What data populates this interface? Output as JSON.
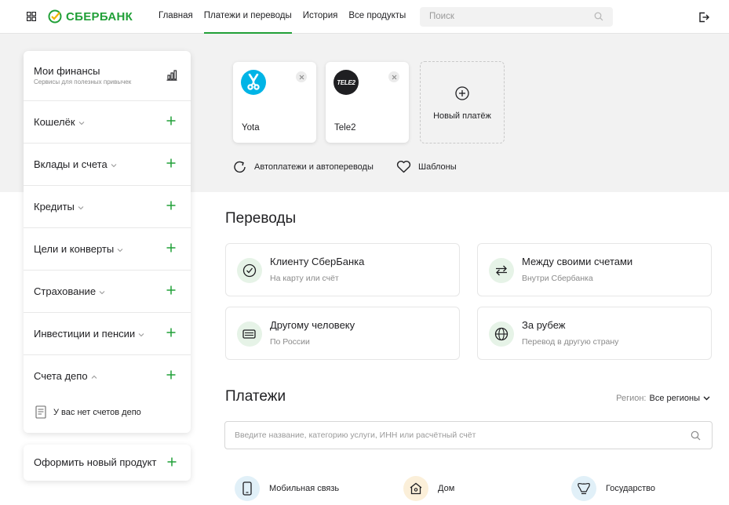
{
  "header": {
    "brand": "СБЕРБАНК",
    "nav": [
      "Главная",
      "Платежи и переводы",
      "История",
      "Все продукты"
    ],
    "active_nav_index": 1,
    "search_placeholder": "Поиск"
  },
  "sidebar": {
    "my_finance": {
      "title": "Мои финансы",
      "subtitle": "Сервисы для полезных привычек"
    },
    "items": [
      {
        "label": "Кошелёк",
        "expanded": false
      },
      {
        "label": "Вклады и счета",
        "expanded": false
      },
      {
        "label": "Кредиты",
        "expanded": false
      },
      {
        "label": "Цели и конверты",
        "expanded": false
      },
      {
        "label": "Страхование",
        "expanded": false
      },
      {
        "label": "Инвестиции и пенсии",
        "expanded": false
      },
      {
        "label": "Счета депо",
        "expanded": true
      }
    ],
    "depo_empty": "У вас нет счетов депо",
    "new_product": "Оформить новый продукт"
  },
  "favorites": {
    "cards": [
      {
        "name": "Yota",
        "icon": "yota-logo"
      },
      {
        "name": "Tele2",
        "icon": "tele2-logo",
        "logo_text": "TELE2"
      }
    ],
    "new_payment": "Новый платёж",
    "autopay": "Автоплатежи и автопереводы",
    "templates": "Шаблоны"
  },
  "transfers": {
    "title": "Переводы",
    "cards": [
      {
        "title": "Клиенту СберБанка",
        "subtitle": "На карту или счёт",
        "icon": "check-circle-icon"
      },
      {
        "title": "Между своими счетами",
        "subtitle": "Внутри Сбербанка",
        "icon": "swap-arrows-icon"
      },
      {
        "title": "Другому человеку",
        "subtitle": "По России",
        "icon": "wallet-icon"
      },
      {
        "title": "За рубеж",
        "subtitle": "Перевод в другую страну",
        "icon": "globe-icon"
      }
    ]
  },
  "payments": {
    "title": "Платежи",
    "region_label": "Регион:",
    "region_value": "Все регионы",
    "search_placeholder": "Введите название, категорию услуги, ИНН или расчётный счёт",
    "categories": [
      {
        "label": "Мобильная связь",
        "icon": "phone-icon"
      },
      {
        "label": "Дом",
        "icon": "house-icon"
      },
      {
        "label": "Государство",
        "icon": "government-icon"
      }
    ]
  },
  "colors": {
    "accent": "#21a038",
    "band": "#f2f2f2",
    "yota": "#00b4e6",
    "tele2": "#1f1f22"
  }
}
